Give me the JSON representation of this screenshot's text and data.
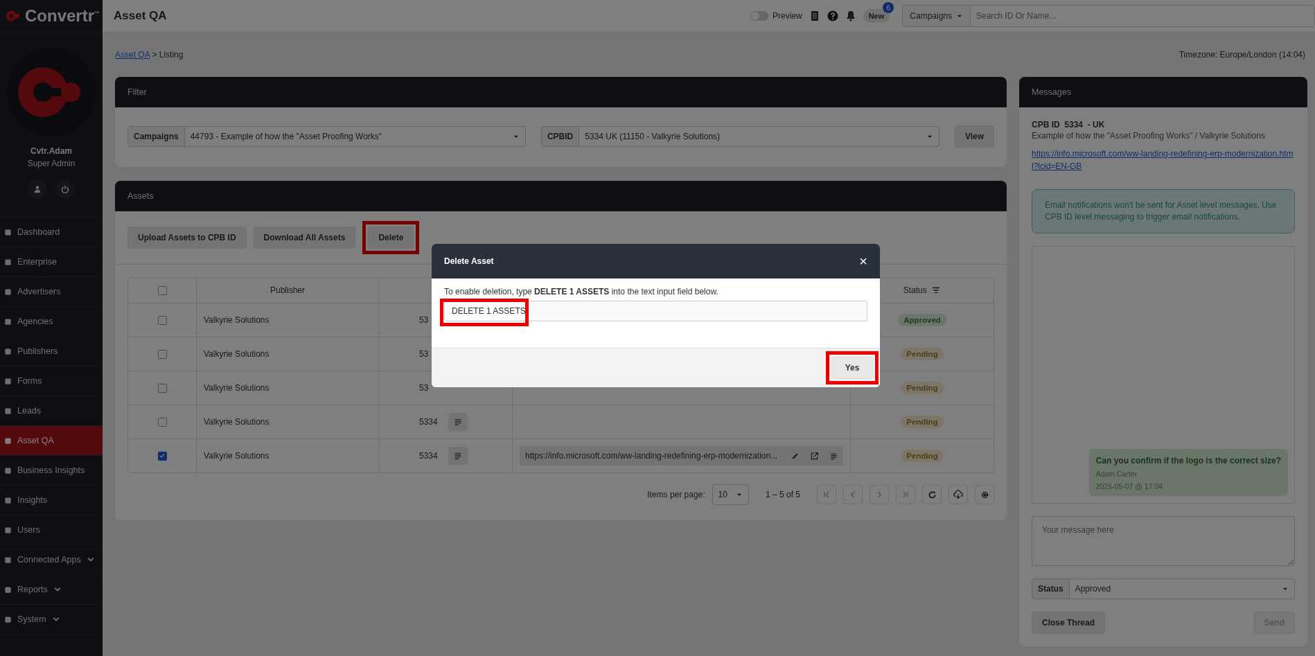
{
  "sidebar": {
    "logo": "Convertr$^{™}$",
    "user": {
      "name": "Cvtr.Adam",
      "role": "Super Admin"
    },
    "items": [
      {
        "label": "Dashboard",
        "selected": false,
        "expandable": false
      },
      {
        "label": "Enterprise",
        "selected": false,
        "expandable": false
      },
      {
        "label": "Advertisers",
        "selected": false,
        "expandable": false
      },
      {
        "label": "Agencies",
        "selected": false,
        "expandable": false
      },
      {
        "label": "Publishers",
        "selected": false,
        "expandable": false
      },
      {
        "label": "Forms",
        "selected": false,
        "expandable": false
      },
      {
        "label": "Leads",
        "selected": false,
        "expandable": false
      },
      {
        "label": "Asset QA",
        "selected": true,
        "expandable": false
      },
      {
        "label": "Business Insights",
        "selected": false,
        "expandable": false
      },
      {
        "label": "Insights",
        "selected": false,
        "expandable": false
      },
      {
        "label": "Users",
        "selected": false,
        "expandable": false
      },
      {
        "label": "Connected Apps",
        "selected": false,
        "expandable": true
      },
      {
        "label": "Reports",
        "selected": false,
        "expandable": true
      },
      {
        "label": "System",
        "selected": false,
        "expandable": true
      }
    ]
  },
  "header": {
    "title": "Asset QA",
    "preview": {
      "label": "Preview",
      "on": false
    },
    "new_button": "New",
    "new_badge": "6",
    "campaign_dropdown": "Campaigns",
    "search": {
      "placeholder": "Search ID Or Name..."
    }
  },
  "breadcrumb": {
    "link": "Asset QA",
    "separator": ">",
    "current": "Listing"
  },
  "timezone": "Timezone: Europe/London (14:04)",
  "filter": {
    "title": "Filter",
    "campaigns_label": "Campaigns",
    "campaigns_value": "44793 - Example of how the \"Asset Proofing Works\"",
    "cpbid_label": "CPBID",
    "cpbid_value": "5334 UK (11150 - Valkyrie Solutions)",
    "view_button": "View"
  },
  "assets": {
    "title": "Assets",
    "buttons": [
      {
        "label": "Upload Assets to CPB ID",
        "highlighted": false
      },
      {
        "label": "Download All Assets",
        "highlighted": false
      },
      {
        "label": "Delete",
        "highlighted": true
      }
    ],
    "table": {
      "select_all_checked": false,
      "columns": [
        "Publisher",
        "Status"
      ],
      "rows": [
        {
          "checked": false,
          "publisher": "Valkyrie Solutions",
          "cpb_id": "53",
          "details_button": false,
          "url": null,
          "status": "Approved",
          "kind": "approved"
        },
        {
          "checked": false,
          "publisher": "Valkyrie Solutions",
          "cpb_id": "53",
          "details_button": false,
          "url": null,
          "status": "Pending",
          "kind": "pending"
        },
        {
          "checked": false,
          "publisher": "Valkyrie Solutions",
          "cpb_id": "53",
          "details_button": false,
          "url": null,
          "status": "Pending",
          "kind": "pending"
        },
        {
          "checked": false,
          "publisher": "Valkyrie Solutions",
          "cpb_id": "5334",
          "details_button": true,
          "url": null,
          "status": "Pending",
          "kind": "pending"
        },
        {
          "checked": true,
          "publisher": "Valkyrie Solutions",
          "cpb_id": "5334",
          "details_button": true,
          "url": "https://info.microsoft.com/ww-landing-redefining-erp-modernization...",
          "status": "Pending",
          "kind": "pending"
        }
      ]
    },
    "pagination": {
      "label": "Items per page:",
      "per_page": "10",
      "range": "1 – 5 of 5"
    }
  },
  "messages": {
    "title": "Messages",
    "cpb_heading": "CPB ID  5334  - UK",
    "subtitle": "Example of how the \"Asset Proofing Works\" / Valkyrie Solutions",
    "link": "https://info.microsoft.com/ww-landing-redefining-erp-modernization.html?lcid=EN-GB",
    "notice": "Email notifications won't be sent for Asset level messages. Use CPB ID level messaging to trigger email notifications.",
    "thread": [
      {
        "text": "Can you confirm if the logo is the correct size?",
        "author": "Adam Carter",
        "time": "2025-05-07 @ 17:04"
      }
    ],
    "message_field": {
      "placeholder": "Your message here"
    },
    "status_label": "Status",
    "status_value": "Approved",
    "close_button": "Close Thread",
    "send_button": {
      "label": "Send",
      "disabled": true
    }
  },
  "modal": {
    "title": "Delete Asset",
    "close": "×",
    "instruction": "To enable deletion, type **DELETE 1 ASSETS** into the text input field below.",
    "input": {
      "value": "DELETE 1 ASSETS",
      "highlighted": true
    },
    "confirm_button": {
      "label": "Yes",
      "highlighted": true
    }
  }
}
